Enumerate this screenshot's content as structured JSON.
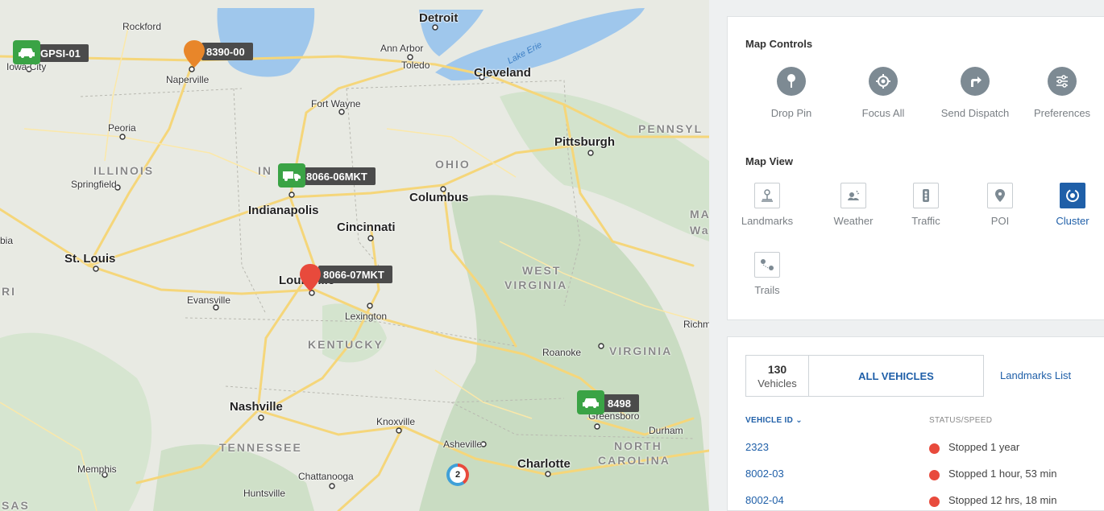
{
  "map": {
    "cities_big": [
      "Detroit",
      "Cleveland",
      "Pittsburgh",
      "Columbus",
      "Indianapolis",
      "Cincinnati",
      "St. Louis",
      "Louisville",
      "Nashville",
      "Charlotte"
    ],
    "cities": [
      "Rockford",
      "Ann Arbor",
      "Toledo",
      "Iowa City",
      "Naperville",
      "Fort Wayne",
      "Peoria",
      "Springfield",
      "Evansville",
      "Lexington",
      "Roanoke",
      "Knoxville",
      "Asheville",
      "Durham",
      "Memphis",
      "Chattanooga",
      "Huntsville",
      "Greensboro",
      "Richmond"
    ],
    "states": [
      "ILLINOIS",
      "IN",
      "OHIO",
      "PENNSYL",
      "WEST",
      "VIRGINIA",
      "KENTUCKY",
      "VIRGINIA",
      "TENNESSEE",
      "NORTH",
      "CAROLINA",
      "MA",
      "Wa",
      "RI",
      "SAS",
      "bia"
    ],
    "lake_label": "Lake Erie",
    "vehicles": [
      {
        "label": "GPSI-01",
        "kind": "car-icon"
      },
      {
        "label": "8390-00",
        "kind": "pin-orange"
      },
      {
        "label": "8066-06MKT",
        "kind": "truck-icon"
      },
      {
        "label": "8066-07MKT",
        "kind": "pin-red"
      },
      {
        "label": "8498",
        "kind": "car-icon"
      }
    ],
    "cluster_count": "2"
  },
  "controls": {
    "title": "Map Controls",
    "items": [
      {
        "label": "Drop Pin",
        "icon": "pin-icon"
      },
      {
        "label": "Focus All",
        "icon": "target-icon"
      },
      {
        "label": "Send Dispatch",
        "icon": "arrow-turn-icon"
      },
      {
        "label": "Preferences",
        "icon": "sliders-icon"
      }
    ]
  },
  "map_view": {
    "title": "Map View",
    "items": [
      {
        "label": "Landmarks",
        "active": false
      },
      {
        "label": "Weather",
        "active": false
      },
      {
        "label": "Traffic",
        "active": false
      },
      {
        "label": "POI",
        "active": false
      },
      {
        "label": "Cluster",
        "active": true
      },
      {
        "label": "Trails",
        "active": false
      }
    ]
  },
  "vehicles_panel": {
    "count": "130",
    "count_label": "Vehicles",
    "all_label": "ALL VEHICLES",
    "landmarks_link": "Landmarks List",
    "col_id": "VEHICLE ID",
    "col_status": "STATUS/SPEED",
    "rows": [
      {
        "id": "2323",
        "status": "Stopped 1 year"
      },
      {
        "id": "8002-03",
        "status": "Stopped 1 hour, 53 min"
      },
      {
        "id": "8002-04",
        "status": "Stopped 12 hrs, 18 min"
      }
    ]
  },
  "colors": {
    "accent": "#1f5fa8",
    "stopped": "#e84a3c",
    "vehicle_green": "#3aa345"
  }
}
